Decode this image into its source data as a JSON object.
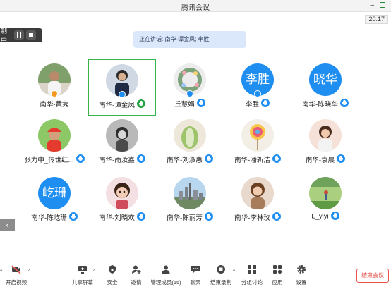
{
  "window": {
    "title": "腾讯会议"
  },
  "clock": "20:17",
  "recording": {
    "label": "制中"
  },
  "speaking": {
    "text": "正在讲话: 南华-谭金凤; 李胜;"
  },
  "participants": [
    {
      "name": "南华-黄隽",
      "avatar_type": "photo",
      "scene": "man",
      "host": true,
      "mic": false,
      "active": false
    },
    {
      "name": "南华-谭金凤",
      "avatar_type": "photo",
      "scene": "woman-dark",
      "host": true,
      "mic": true,
      "mic_color": "green",
      "active": true
    },
    {
      "name": "丘慧娟",
      "avatar_type": "photo",
      "scene": "wreath",
      "host": true,
      "mic": true,
      "active": false
    },
    {
      "name": "李胜",
      "avatar_type": "text",
      "avatar_text": "李胜",
      "host": true,
      "mic": true,
      "active": false
    },
    {
      "name": "南华-陈晓华",
      "avatar_type": "text",
      "avatar_text": "晓华",
      "host": false,
      "mic": true,
      "active": false
    },
    {
      "name": "张力中_传世红...",
      "avatar_type": "photo",
      "scene": "cap",
      "host": false,
      "mic": true,
      "active": false
    },
    {
      "name": "南华-雨汝鑫",
      "avatar_type": "photo",
      "scene": "bw-girl",
      "host": false,
      "mic": true,
      "active": false
    },
    {
      "name": "南华-刘淑惠",
      "avatar_type": "photo",
      "scene": "cabbage",
      "host": false,
      "mic": true,
      "active": false
    },
    {
      "name": "南华-潘新洁",
      "avatar_type": "photo",
      "scene": "lollipop",
      "host": false,
      "mic": true,
      "active": false
    },
    {
      "name": "南华-袁晨",
      "avatar_type": "photo",
      "scene": "woman-light",
      "host": false,
      "mic": true,
      "active": false
    },
    {
      "name": "南华-陈屹珊",
      "avatar_type": "text",
      "avatar_text": "屹珊",
      "host": false,
      "mic": true,
      "active": false
    },
    {
      "name": "南华-刘晓欢",
      "avatar_type": "photo",
      "scene": "cartoon",
      "host": false,
      "mic": true,
      "active": false
    },
    {
      "name": "南华-陈丽芳",
      "avatar_type": "photo",
      "scene": "city",
      "host": false,
      "mic": true,
      "active": false
    },
    {
      "name": "南华-李林玫",
      "avatar_type": "photo",
      "scene": "woman-brown",
      "host": false,
      "mic": true,
      "active": false
    },
    {
      "name": "L_yiyi",
      "avatar_type": "photo",
      "scene": "field",
      "host": false,
      "mic": true,
      "active": false
    }
  ],
  "toolbar": {
    "video": "开启视频",
    "share": "共享屏幕",
    "security": "安全",
    "invite": "邀请",
    "members": "管理成员(15)",
    "chat": "聊天",
    "record": "结束录制",
    "breakout": "分组讨论",
    "apps": "应用",
    "settings": "设置",
    "end": "结束会议"
  },
  "colors": {
    "accent": "#1f8ef1",
    "active_border": "#37b34a",
    "end": "#e5534b",
    "host_badge": "#f39a1e"
  }
}
